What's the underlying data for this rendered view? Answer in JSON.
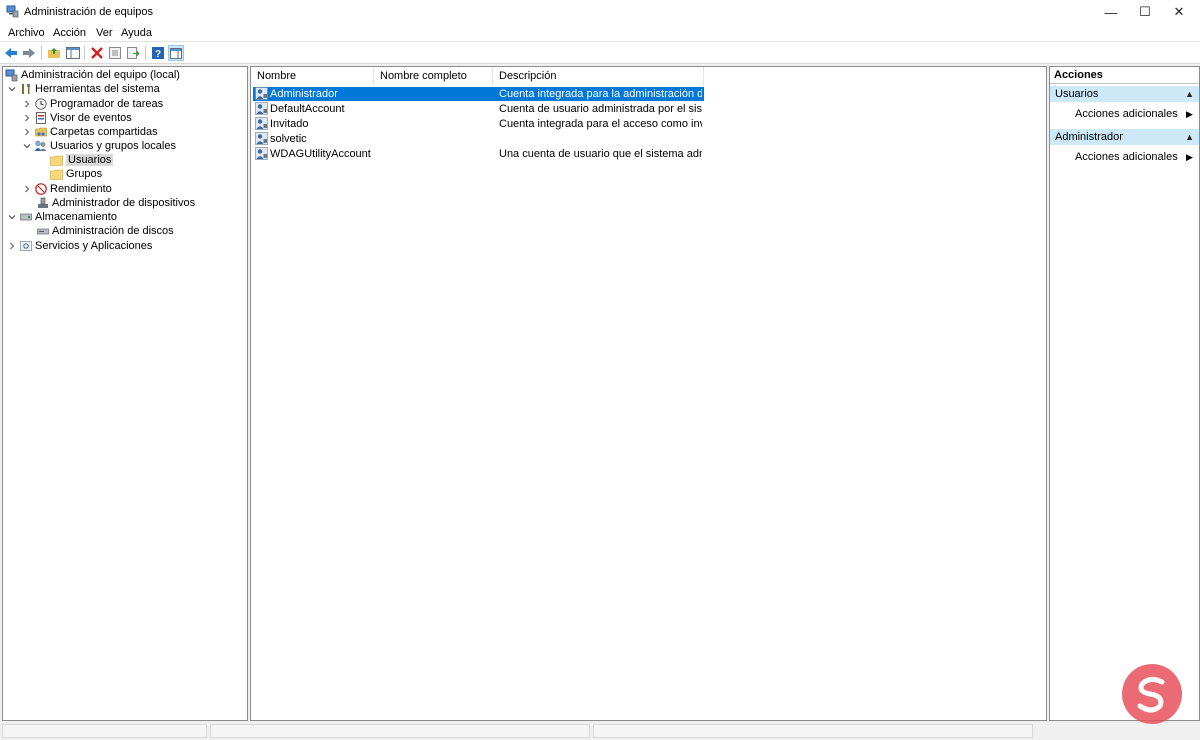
{
  "window": {
    "title": "Administración de equipos",
    "controls": {
      "minimize": "—",
      "maximize": "☐",
      "close": "✕"
    }
  },
  "menu": [
    "Archivo",
    "Acción",
    "Ver",
    "Ayuda"
  ],
  "toolbar": [
    "back-icon",
    "forward-icon",
    "up-folder-icon",
    "show-hide-tree-icon",
    "delete-icon",
    "properties-icon",
    "export-list-icon",
    "help-icon",
    "show-hide-action-pane-icon"
  ],
  "tree": {
    "root": "Administración del equipo (local)",
    "system_tools": "Herramientas del sistema",
    "task_scheduler": "Programador de tareas",
    "event_viewer": "Visor de eventos",
    "shared_folders": "Carpetas compartidas",
    "local_users_groups": "Usuarios y grupos locales",
    "users": "Usuarios",
    "groups": "Grupos",
    "performance": "Rendimiento",
    "device_manager": "Administrador de dispositivos",
    "storage": "Almacenamiento",
    "disk_management": "Administración de discos",
    "services_apps": "Servicios y Aplicaciones"
  },
  "list": {
    "columns": [
      "Nombre",
      "Nombre completo",
      "Descripción"
    ],
    "rows": [
      {
        "name": "Administrador",
        "full_name": "",
        "description": "Cuenta integrada para la administración del e..."
      },
      {
        "name": "DefaultAccount",
        "full_name": "",
        "description": "Cuenta de usuario administrada por el sistema."
      },
      {
        "name": "Invitado",
        "full_name": "",
        "description": "Cuenta integrada para el acceso como invitad..."
      },
      {
        "name": "solvetic",
        "full_name": "",
        "description": ""
      },
      {
        "name": "WDAGUtilityAccount",
        "full_name": "",
        "description": "Una cuenta de usuario que el sistema adminis..."
      }
    ]
  },
  "actions": {
    "header": "Acciones",
    "sections": [
      {
        "title": "Usuarios",
        "item": "Acciones adicionales"
      },
      {
        "title": "Administrador",
        "item": "Acciones adicionales"
      }
    ]
  },
  "colors": {
    "selection": "#0078d7",
    "section": "#cde8f7",
    "watermark": "#e8505b"
  }
}
